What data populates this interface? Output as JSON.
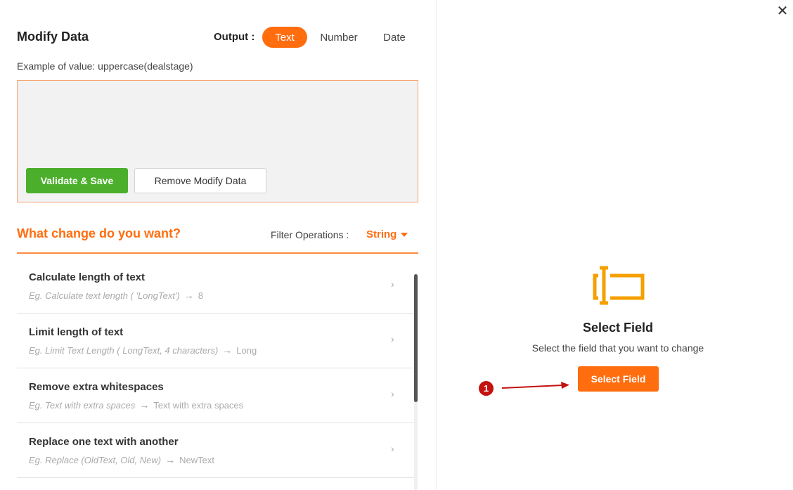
{
  "header": {
    "title": "Modify Data",
    "output_label": "Output :",
    "output_options": [
      {
        "label": "Text",
        "active": true
      },
      {
        "label": "Number",
        "active": false
      },
      {
        "label": "Date",
        "active": false
      }
    ],
    "example_text": "Example of value: uppercase(dealstage)"
  },
  "editor": {
    "value": "",
    "validate_label": "Validate & Save",
    "remove_label": "Remove Modify Data"
  },
  "operations": {
    "heading": "What change do you want?",
    "filter_label": "Filter Operations :",
    "filter_value": "String",
    "items": [
      {
        "title": "Calculate length of text",
        "example": "Eg. Calculate text length ( 'LongText')",
        "result": "8"
      },
      {
        "title": "Limit length of text",
        "example": "Eg. Limit Text Length ( LongText, 4 characters)",
        "result": "Long"
      },
      {
        "title": "Remove extra whitespaces",
        "example": "Eg. Text with extra spaces",
        "result": "Text with extra spaces"
      },
      {
        "title": "Replace one text with another",
        "example": "Eg. Replace (OldText, Old, New)",
        "result": "NewText"
      }
    ]
  },
  "select_field": {
    "title": "Select Field",
    "description": "Select the field that you want to change",
    "button_label": "Select Field",
    "marker_number": "1"
  },
  "colors": {
    "accent": "#ff6d0f",
    "success": "#4caf2c",
    "marker": "#c3120f",
    "icon": "#f5a000"
  },
  "icons": {
    "close": "close-icon",
    "field": "field-selector-icon",
    "chevron": "chevron-right-icon",
    "arrow": "arrow-right-icon"
  }
}
